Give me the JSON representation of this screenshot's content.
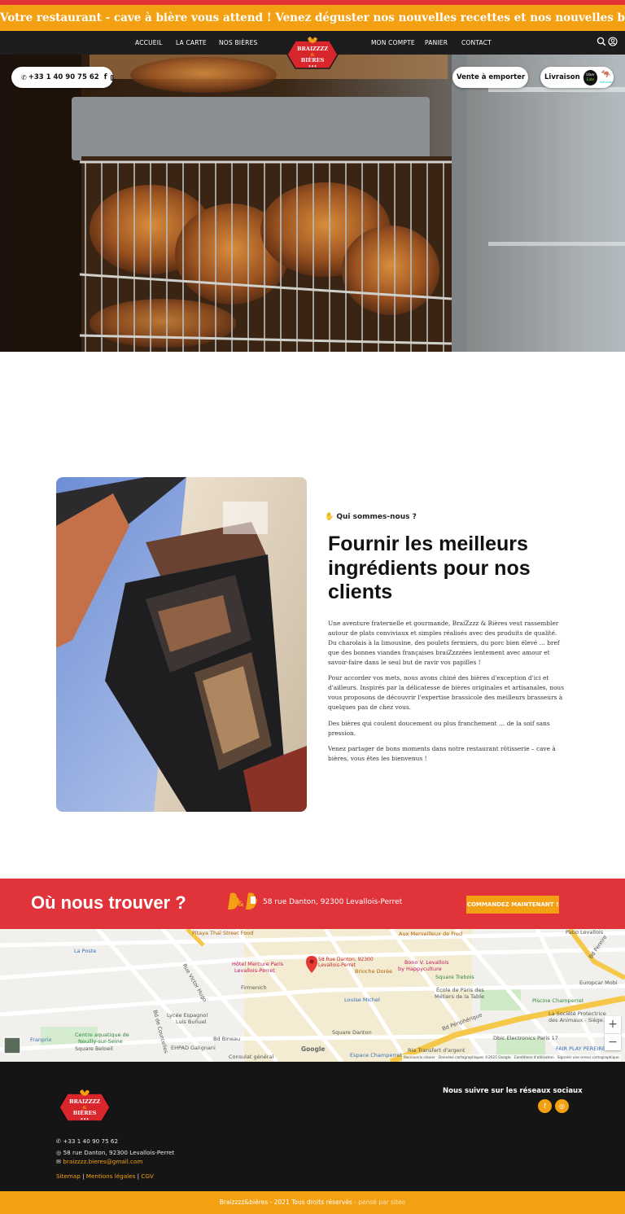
{
  "banner": {
    "text": "Votre restaurant - cave à bière vous attend ! Venez déguster nos nouvelles recettes et nos nouvelles bières artisanales !!!"
  },
  "nav": {
    "left": [
      "ACCUEIL",
      "LA CARTE",
      "NOS BIÈRES"
    ],
    "right": [
      "MON COMPTE",
      "PANIER",
      "CONTACT"
    ],
    "logo_text": [
      "BRAIZZZZ",
      "&",
      "BIÈRES"
    ]
  },
  "hero": {
    "phone": "+33 1 40 90 75 62",
    "takeaway": "Vente à emporter",
    "delivery": "Livraison",
    "uber": [
      "Uber",
      "Eats"
    ],
    "deliveroo": "deliveroo"
  },
  "about": {
    "kicker": "Qui sommes-nous ?",
    "title": "Fournir les meilleurs ingrédients pour nos clients",
    "paragraphs": [
      "Une aventure fraternelle et gourmande, BraiZzzz & Bières veut rassembler autour de plats conviviaux et simples réalisés avec des produits de qualité. Du charolais à la limousine, des poulets fermiers, du porc bien élevé … bref que des bonnes viandes françaises braiZzzzées lentement avec amour et savoir-faire dans le seul but de ravir vos papilles !",
      "Pour accorder vos mets, nous avons chiné des bières d'exception d'ici et d'ailleurs. Inspirés par la délicatesse de bières originales et artisanales, nous vous proposons de découvrir l'expertise brassicole des meilleurs brasseurs à quelques pas de chez vous.",
      "Des bières qui coulent doucement ou plus franchement … de la soif sans pression.",
      "Venez partager de bons moments dans notre restaurant rôtisserie – cave à bières, vous êtes les bienvenus !"
    ]
  },
  "locate": {
    "title": "Où nous trouver ?",
    "address": "58 rue Danton, 92300 Levallois-Perret",
    "button": "COMMANDEZ MAINTENANT !"
  },
  "map": {
    "pin_label": [
      "58 Rue Danton, 92300",
      "Levallois-Perret"
    ],
    "places": [
      "Pitaya Thaï Street Food",
      "Aux Merveilleux de Fred",
      "La Poste",
      "Hôtel Mercure Paris",
      "Levallois-Perret",
      "Brioche Dorée",
      "Bono V. Levallois",
      "by Happyculture",
      "Square Trebois",
      "Firmenich",
      "Louise Michel",
      "École de Paris des",
      "Métiers de la Table",
      "Piscine Champerret",
      "Lycée Espagnol",
      "Luis Buñuel",
      "Centre aquatique de",
      "Neuilly-sur-Seine",
      "Franprix",
      "Square Beloeil",
      "EHPAD Galignani",
      "Consulat général",
      "Square Danton",
      "Espace Champerret",
      "Ria Transfert d'argent",
      "Dbic Electronics Paris 17",
      "FAIR PLAY PEREIRE",
      "Europcar Mobi",
      "La Société Protectrice",
      "des Animaux - Siège...",
      "Patio Levallois",
      "Bd Périphérique",
      "Bd Bineau",
      "Rue Victor Hugo",
      "Bd de Courcelles",
      "Bd Pereire"
    ],
    "attribution": [
      "Raccourcis clavier",
      "Données cartographiques ©2021 Google",
      "Conditions d'utilisation",
      "Signaler une erreur cartographique"
    ],
    "google": "Google",
    "zoom_in": "+",
    "zoom_out": "−"
  },
  "footer": {
    "phone": "+33 1 40 90 75 62",
    "address": "58 rue Danton, 92300 Levallois-Perret",
    "email": "braizzzz.bieres@gmail.com",
    "links": [
      "Sitemap",
      "Mentions légales",
      "CGV"
    ],
    "social_title": "Nous suivre sur les réseaux sociaux",
    "copyright": "Braizzzz&bières - 2021 Tous droits réservés",
    "credit": "- pensé par siteo"
  },
  "colors": {
    "orange": "#f3a012",
    "red": "#e1333a",
    "dark": "#1d1d1d"
  }
}
